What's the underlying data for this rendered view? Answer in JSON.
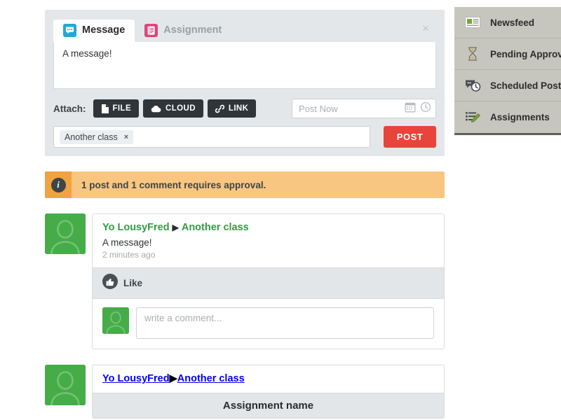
{
  "composer": {
    "tabs": [
      {
        "label": "Message",
        "icon": "speech-bubble-icon",
        "active": true,
        "color": "#22a7d8"
      },
      {
        "label": "Assignment",
        "icon": "assignment-doc-icon",
        "active": false,
        "color": "#e0457b"
      }
    ],
    "close_label": "×",
    "message_text": "A message!",
    "attach_label": "Attach:",
    "attach_buttons": [
      {
        "label": "FILE",
        "icon": "file-icon"
      },
      {
        "label": "CLOUD",
        "icon": "cloud-icon"
      },
      {
        "label": "LINK",
        "icon": "link-icon"
      }
    ],
    "schedule": {
      "placeholder": "Post Now",
      "value": "",
      "calendar_icon": "calendar-icon",
      "clock_icon": "clock-icon"
    },
    "recipients": {
      "chips": [
        {
          "label": "Another class",
          "remove": "×"
        }
      ],
      "placeholder": ""
    },
    "post_button": "POST",
    "post_button_color": "#e8443c"
  },
  "alert": {
    "icon": "info-icon",
    "glyph": "i",
    "text": "1 post and 1 comment requires approval.",
    "bg_color": "#f8c680",
    "icon_bg_color": "#f0a33e"
  },
  "feed": {
    "posts": [
      {
        "author": "Yo LousyFred",
        "separator": "▶",
        "target": "Another class",
        "body": "A message!",
        "time": "2 minutes ago",
        "like_label": "Like",
        "like_icon": "thumbs-up-icon",
        "comment_placeholder": "write a comment...",
        "avatar": "user-avatar",
        "type": "message"
      },
      {
        "author": "Yo LousyFred",
        "separator": "▶",
        "target": "Another class",
        "assignment_title": "Assignment name",
        "avatar": "user-avatar",
        "type": "assignment"
      }
    ]
  },
  "sidebar": {
    "items": [
      {
        "label": "Newsfeed",
        "icon": "newsfeed-icon"
      },
      {
        "label": "Pending Approval",
        "icon": "hourglass-icon"
      },
      {
        "label": "Scheduled Posts",
        "icon": "scheduled-posts-icon"
      },
      {
        "label": "Assignments",
        "icon": "assignments-pencil-icon"
      }
    ],
    "bg_color": "#c6c6be"
  }
}
